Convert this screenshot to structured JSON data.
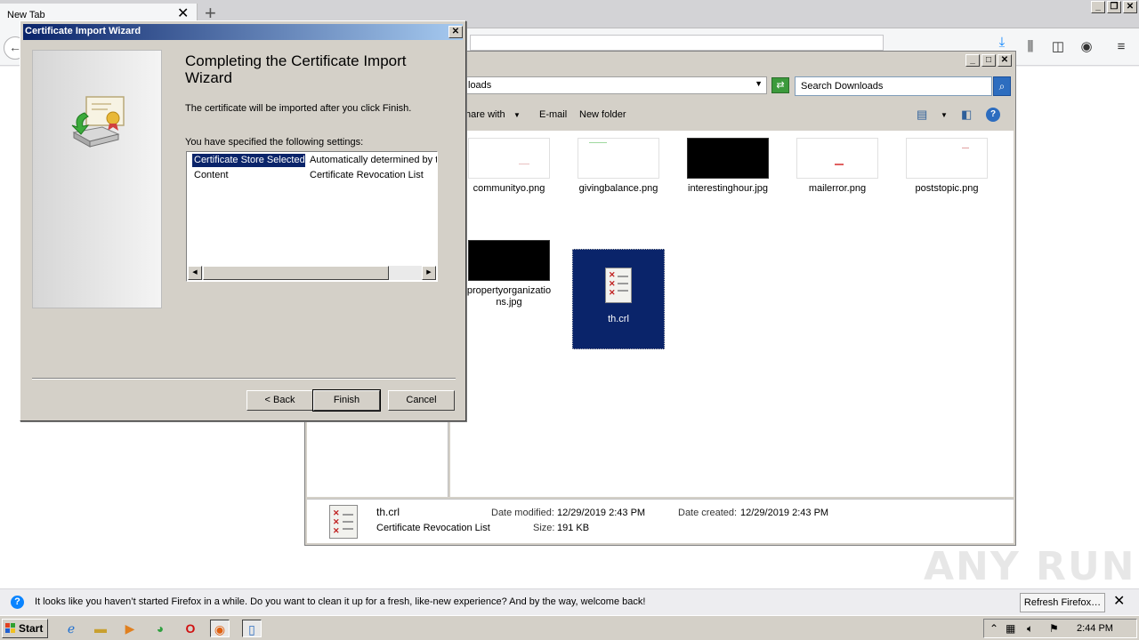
{
  "browser": {
    "tab_title": "New Tab",
    "notification_text": "It looks like you haven’t started Firefox in a while. Do you want to clean it up for a fresh, like-new experience? And by the way, welcome back!",
    "refresh_button": "Refresh Firefox…"
  },
  "explorer": {
    "address": "loads",
    "search_placeholder": "Search Downloads",
    "toolbar": {
      "share": "hare with",
      "email": "E-mail",
      "new_folder": "New folder"
    },
    "files": [
      {
        "name": "communityo.png",
        "thumb": "light"
      },
      {
        "name": "givingbalance.png",
        "thumb": "light"
      },
      {
        "name": "interestinghour.jpg",
        "thumb": "dark"
      },
      {
        "name": "mailerror.png",
        "thumb": "light"
      },
      {
        "name": "poststopic.png",
        "thumb": "light"
      },
      {
        "name": "propertyorganizations.jpg",
        "name_line1": "propertyorganizatio",
        "name_line2": "ns.jpg",
        "thumb": "dark"
      },
      {
        "name": "th.crl",
        "thumb": "crl",
        "selected": true
      }
    ],
    "details": {
      "file_name": "th.crl",
      "file_type": "Certificate Revocation List",
      "date_modified_label": "Date modified:",
      "date_modified": "12/29/2019 2:43 PM",
      "date_created_label": "Date created:",
      "date_created": "12/29/2019 2:43 PM",
      "size_label": "Size:",
      "size": "191 KB"
    }
  },
  "wizard": {
    "title": "Certificate Import Wizard",
    "heading": "Completing the Certificate Import Wizard",
    "intro": "The certificate will be imported after you click Finish.",
    "settings_label": "You have specified the following settings:",
    "settings": [
      {
        "name": "Certificate Store Selected",
        "value": "Automatically determined by t"
      },
      {
        "name": "Content",
        "value": "Certificate Revocation List"
      }
    ],
    "buttons": {
      "back": "< Back",
      "finish": "Finish",
      "cancel": "Cancel"
    }
  },
  "taskbar": {
    "start_label": "Start",
    "clock": "2:44 PM"
  },
  "watermark": "ANY RUN",
  "colors": {
    "selection": "#0a246a",
    "title_bar": "#0a246a",
    "window_face": "#d4d0c8",
    "firefox_accent": "#0a84ff"
  }
}
